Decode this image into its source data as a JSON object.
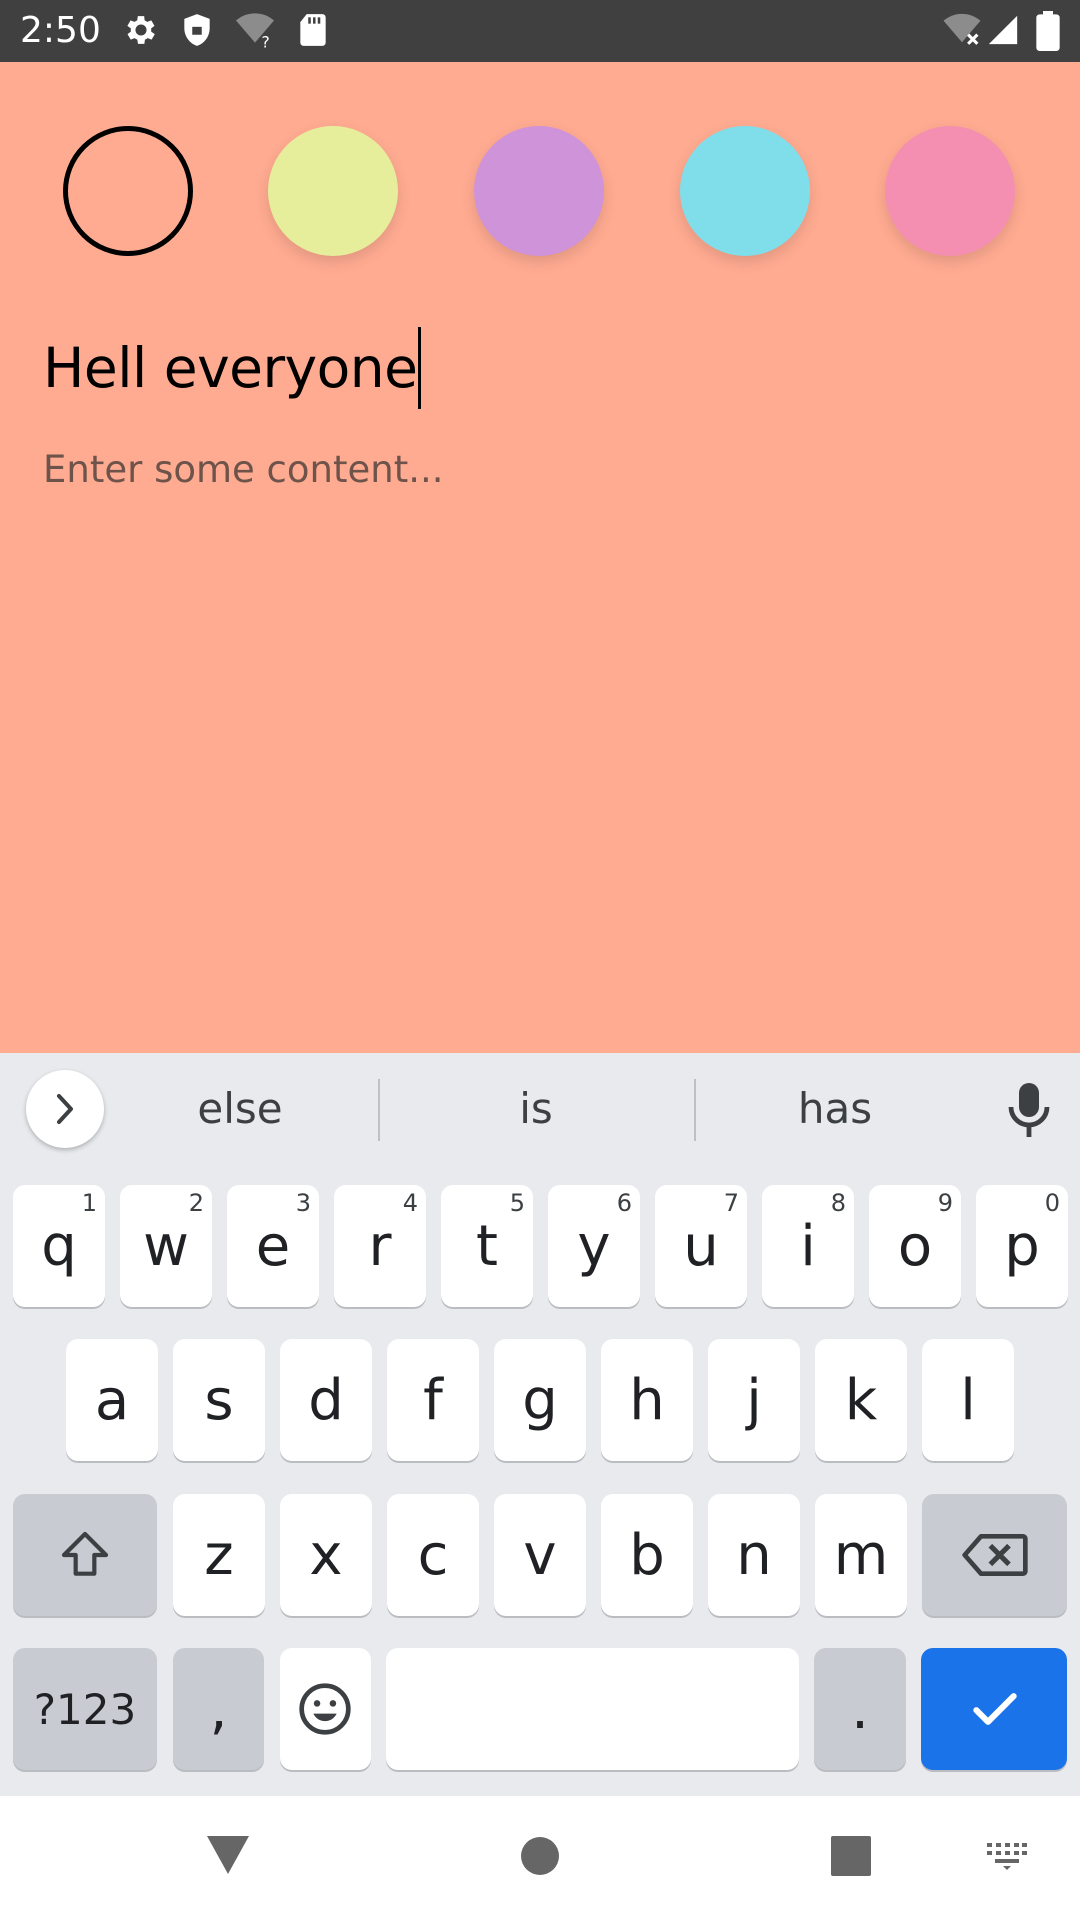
{
  "status_bar": {
    "time": "2:50",
    "left_icons": [
      "settings-icon",
      "shield-icon",
      "wifi-unknown-icon",
      "sd-card-icon"
    ],
    "right_icons": [
      "wifi-off-icon",
      "signal-icon",
      "battery-icon"
    ]
  },
  "color_picker": {
    "swatches": [
      {
        "name": "coral",
        "color": "#FFAB91",
        "selected": true
      },
      {
        "name": "yellow",
        "color": "#E6EE9B",
        "selected": false
      },
      {
        "name": "purple",
        "color": "#CF93D9",
        "selected": false
      },
      {
        "name": "cyan",
        "color": "#80DEEA",
        "selected": false
      },
      {
        "name": "pink",
        "color": "#F48FB1",
        "selected": false
      }
    ]
  },
  "note": {
    "title_value": "Hell everyone",
    "content_placeholder": "Enter some content...",
    "background_color": "#FFAB91"
  },
  "keyboard": {
    "suggestions": [
      "else",
      "is",
      "has"
    ],
    "row1": [
      {
        "key": "q",
        "hint": "1"
      },
      {
        "key": "w",
        "hint": "2"
      },
      {
        "key": "e",
        "hint": "3"
      },
      {
        "key": "r",
        "hint": "4"
      },
      {
        "key": "t",
        "hint": "5"
      },
      {
        "key": "y",
        "hint": "6"
      },
      {
        "key": "u",
        "hint": "7"
      },
      {
        "key": "i",
        "hint": "8"
      },
      {
        "key": "o",
        "hint": "9"
      },
      {
        "key": "p",
        "hint": "0"
      }
    ],
    "row2": [
      "a",
      "s",
      "d",
      "f",
      "g",
      "h",
      "j",
      "k",
      "l"
    ],
    "row3": [
      "z",
      "x",
      "c",
      "v",
      "b",
      "n",
      "m"
    ],
    "symbols_label": "?123",
    "comma_label": ",",
    "period_label": ".",
    "accent_color": "#1A73E8"
  },
  "nav_bar": {
    "buttons": [
      "back-icon",
      "home-icon",
      "recents-icon",
      "keyboard-switch-icon"
    ]
  }
}
